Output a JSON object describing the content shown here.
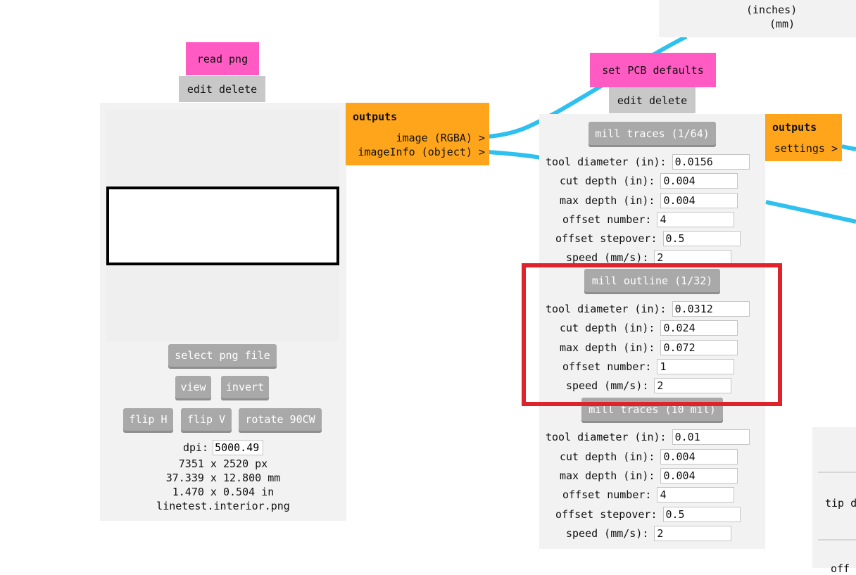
{
  "read_png": {
    "title": "read png",
    "edit_label": "edit",
    "delete_label": "delete",
    "select_button": "select png file",
    "view_button": "view",
    "invert_button": "invert",
    "flip_h_button": "flip H",
    "flip_v_button": "flip V",
    "rotate_button": "rotate 90CW",
    "dpi_label": "dpi:",
    "dpi_value": "5000.49",
    "size_px": "7351 x 2520 px",
    "size_mm": "37.339 x 12.800 mm",
    "size_in": "1.470 x 0.504 in",
    "filename": "linetest.interior.png",
    "outputs_header": "outputs",
    "output_image": "image (RGBA) >",
    "output_info": "imageInfo (object) >"
  },
  "pcb_defaults": {
    "title": "set PCB defaults",
    "edit_label": "edit",
    "delete_label": "delete",
    "outputs_header": "outputs",
    "output_settings": "settings >",
    "sections": {
      "traces_164": {
        "button": "mill traces (1/64)",
        "tool_diameter_label": "tool diameter (in):",
        "tool_diameter": "0.0156",
        "cut_depth_label": "cut depth (in):",
        "cut_depth": "0.004",
        "max_depth_label": "max depth (in):",
        "max_depth": "0.004",
        "offset_number_label": "offset number:",
        "offset_number": "4",
        "offset_stepover_label": "offset stepover:",
        "offset_stepover": "0.5",
        "speed_label": "speed (mm/s):",
        "speed": "2"
      },
      "outline_132": {
        "button": "mill outline (1/32)",
        "tool_diameter_label": "tool diameter (in):",
        "tool_diameter": "0.0312",
        "cut_depth_label": "cut depth (in):",
        "cut_depth": "0.024",
        "max_depth_label": "max depth (in):",
        "max_depth": "0.072",
        "offset_number_label": "offset number:",
        "offset_number": "1",
        "speed_label": "speed (mm/s):",
        "speed": "2"
      },
      "traces_10mil": {
        "button": "mill traces (10 mil)",
        "tool_diameter_label": "tool diameter (in):",
        "tool_diameter": "0.01",
        "cut_depth_label": "cut depth (in):",
        "cut_depth": "0.004",
        "max_depth_label": "max depth (in):",
        "max_depth": "0.004",
        "offset_number_label": "offset number:",
        "offset_number": "4",
        "offset_stepover_label": "offset stepover:",
        "offset_stepover": "0.5",
        "speed_label": "speed (mm/s):",
        "speed": "2"
      }
    }
  },
  "top_right": {
    "line1": "(inches)",
    "line2": "(mm)"
  },
  "bottom_right": {
    "tip_text": "tip d",
    "off_text": "off"
  },
  "colors": {
    "title_pink": "#ff5bc3",
    "outputs_orange": "#ffa51c",
    "wire_blue": "#2ec0ee",
    "highlight_red": "#e0232b"
  }
}
